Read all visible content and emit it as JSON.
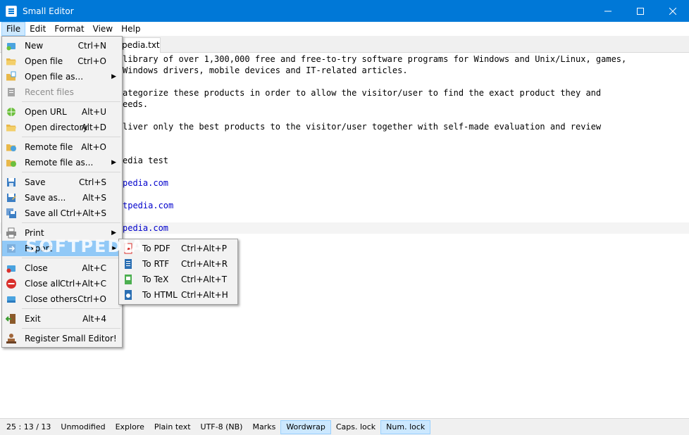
{
  "window": {
    "title": "Small Editor"
  },
  "menubar": [
    "File",
    "Edit",
    "Format",
    "View",
    "Help"
  ],
  "tab": {
    "label": "pedia.txt"
  },
  "editor": {
    "lines": [
      "library of over 1,300,000 free and free-to-try software programs for Windows and Unix/Linux, games,",
      "Windows drivers, mobile devices and IT-related articles.",
      "ategorize these products in order to allow the visitor/user to find the exact product they and",
      "eeds.",
      "liver only the best products to the visitor/user together with self-made evaluation and review",
      "edia test",
      "pedia.com",
      "tpedia.com",
      "pedia.com"
    ]
  },
  "file_menu": {
    "items": [
      {
        "label": "New",
        "shortcut": "Ctrl+N",
        "icon": "new-file-icon"
      },
      {
        "label": "Open file",
        "shortcut": "Ctrl+O",
        "icon": "open-file-icon"
      },
      {
        "label": "Open file as...",
        "shortcut": "",
        "icon": "open-file-as-icon",
        "submenu": true
      },
      {
        "label": "Recent files",
        "shortcut": "",
        "icon": "recent-files-icon",
        "disabled": true
      },
      {
        "label": "Open URL",
        "shortcut": "Alt+U",
        "icon": "open-url-icon"
      },
      {
        "label": "Open directory",
        "shortcut": "Alt+D",
        "icon": "open-directory-icon"
      },
      {
        "label": "Remote file",
        "shortcut": "Alt+O",
        "icon": "remote-file-icon"
      },
      {
        "label": "Remote file as...",
        "shortcut": "",
        "icon": "remote-file-as-icon",
        "submenu": true
      },
      {
        "label": "Save",
        "shortcut": "Ctrl+S",
        "icon": "save-icon"
      },
      {
        "label": "Save as...",
        "shortcut": "Alt+S",
        "icon": "save-as-icon"
      },
      {
        "label": "Save all",
        "shortcut": "Ctrl+Alt+S",
        "icon": "save-all-icon"
      },
      {
        "label": "Print",
        "shortcut": "",
        "icon": "print-icon",
        "submenu": true
      },
      {
        "label": "Export",
        "shortcut": "",
        "icon": "export-icon",
        "submenu": true
      },
      {
        "label": "Close",
        "shortcut": "Alt+C",
        "icon": "close-file-icon"
      },
      {
        "label": "Close all",
        "shortcut": "Ctrl+Alt+C",
        "icon": "close-all-icon"
      },
      {
        "label": "Close others",
        "shortcut": "Ctrl+O",
        "icon": "close-others-icon"
      },
      {
        "label": "Exit",
        "shortcut": "Alt+4",
        "icon": "exit-icon"
      },
      {
        "label": "Register Small Editor!",
        "shortcut": "",
        "icon": "register-icon"
      }
    ]
  },
  "export_menu": {
    "items": [
      {
        "label": "To PDF",
        "shortcut": "Ctrl+Alt+P",
        "icon": "pdf-icon"
      },
      {
        "label": "To RTF",
        "shortcut": "Ctrl+Alt+R",
        "icon": "rtf-icon"
      },
      {
        "label": "To TeX",
        "shortcut": "Ctrl+Alt+T",
        "icon": "tex-icon"
      },
      {
        "label": "To HTML",
        "shortcut": "Ctrl+Alt+H",
        "icon": "html-icon"
      }
    ]
  },
  "statusbar": {
    "position": "25 : 13 / 13",
    "modified": "Unmodified",
    "explore": "Explore",
    "syntax": "Plain text",
    "encoding": "UTF-8 (NB)",
    "marks": "Marks",
    "wordwrap": "Wordwrap",
    "caps": "Caps. lock",
    "num": "Num. lock"
  },
  "watermark": "SOFTPEDIA",
  "colors": {
    "titlebar": "#0078d7",
    "menu_highlight": "#91c9f7",
    "toggle_on": "#cce8ff",
    "link": "#0000cc"
  }
}
